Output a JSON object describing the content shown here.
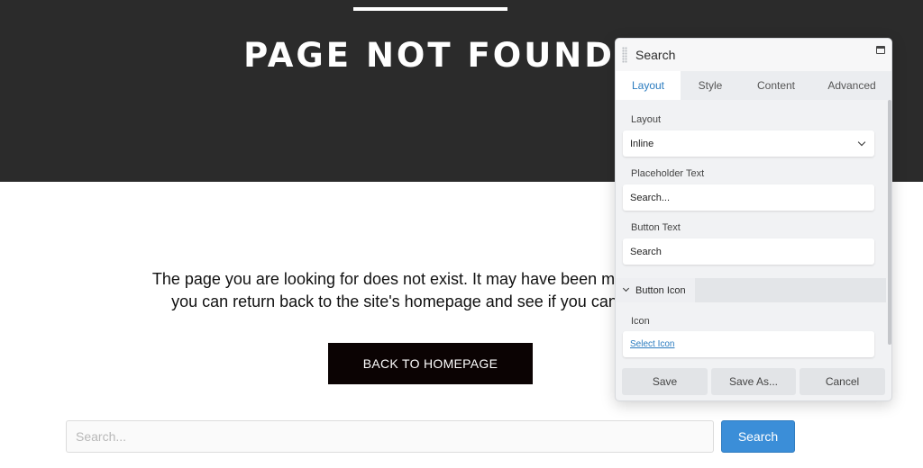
{
  "hero": {
    "title": "PAGE NOT FOUND"
  },
  "content": {
    "message_line1": "The page you are looking for does not exist. It may have been moved, or rem",
    "message_line2": "you can return back to the site's homepage and see if you can find what",
    "home_button": "BACK TO HOMEPAGE"
  },
  "search": {
    "placeholder": "Search...",
    "button_label": "Search"
  },
  "panel": {
    "title": "Search",
    "tabs": [
      {
        "label": "Layout",
        "active": true
      },
      {
        "label": "Style",
        "active": false
      },
      {
        "label": "Content",
        "active": false
      },
      {
        "label": "Advanced",
        "active": false
      }
    ],
    "layout_label": "Layout",
    "layout_value": "Inline",
    "placeholder_label": "Placeholder Text",
    "placeholder_value": "Search...",
    "button_text_label": "Button Text",
    "button_text_value": "Search",
    "section_title": "Button Icon",
    "icon_label": "Icon",
    "icon_link": "Select Icon",
    "footer": {
      "save": "Save",
      "save_as": "Save As...",
      "cancel": "Cancel"
    }
  },
  "colors": {
    "hero_bg": "#2b2b2b",
    "accent": "#3b8ed8",
    "tab_active_text": "#2a7bbf",
    "button_dark": "#0b0303"
  }
}
